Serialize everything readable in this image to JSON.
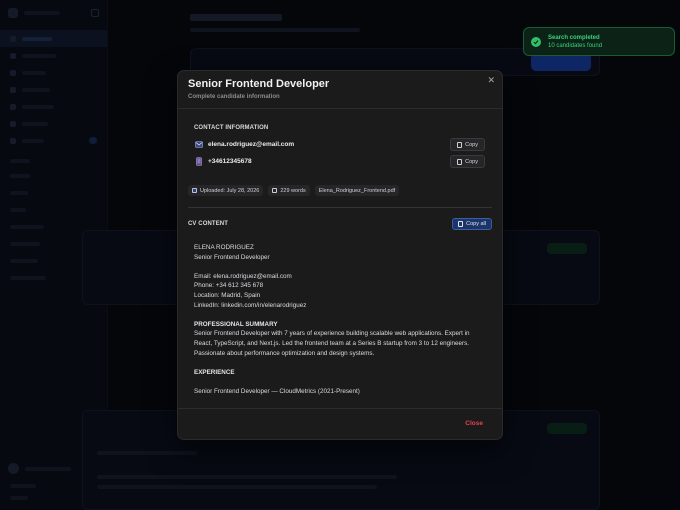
{
  "modal": {
    "title": "Senior Frontend Developer",
    "subtitle": "Complete candidate information",
    "contact": {
      "label": "CONTACT INFORMATION",
      "email": "elena.rodriguez@email.com",
      "phone": "+34612345678",
      "copy_label": "Copy"
    },
    "meta": {
      "uploaded": "Uploaded: July 28, 2026",
      "words": "229 words",
      "filename": "Elena_Rodriguez_Frontend.pdf"
    },
    "cv": {
      "label": "CV CONTENT",
      "copy_all_label": "Copy all",
      "name": "ELENA RODRIGUEZ",
      "role": "Senior Frontend Developer",
      "email_line": "Email: elena.rodriguez@email.com",
      "phone_line": "Phone: +34 612 345 678",
      "location_line": "Location: Madrid, Spain",
      "linkedin_line": "LinkedIn: linkedin.com/in/elenarodriguez",
      "summary_heading": "PROFESSIONAL SUMMARY",
      "summary_text": "Senior Frontend Developer with 7 years of experience building scalable web applications. Expert in React, TypeScript, and Next.js. Led the frontend team at a Series B startup from 3 to 12 engineers. Passionate about performance optimization and design systems.",
      "experience_heading": "EXPERIENCE",
      "experience_line": "Senior Frontend Developer — CloudMetrics (2021-Present)"
    },
    "footer": {
      "close_label": "Close"
    }
  },
  "toast": {
    "title": "Search completed",
    "message": "10 candidates found"
  },
  "colors": {
    "accent_blue": "#1d3566",
    "danger": "#e5424f",
    "success": "#39d27a"
  }
}
